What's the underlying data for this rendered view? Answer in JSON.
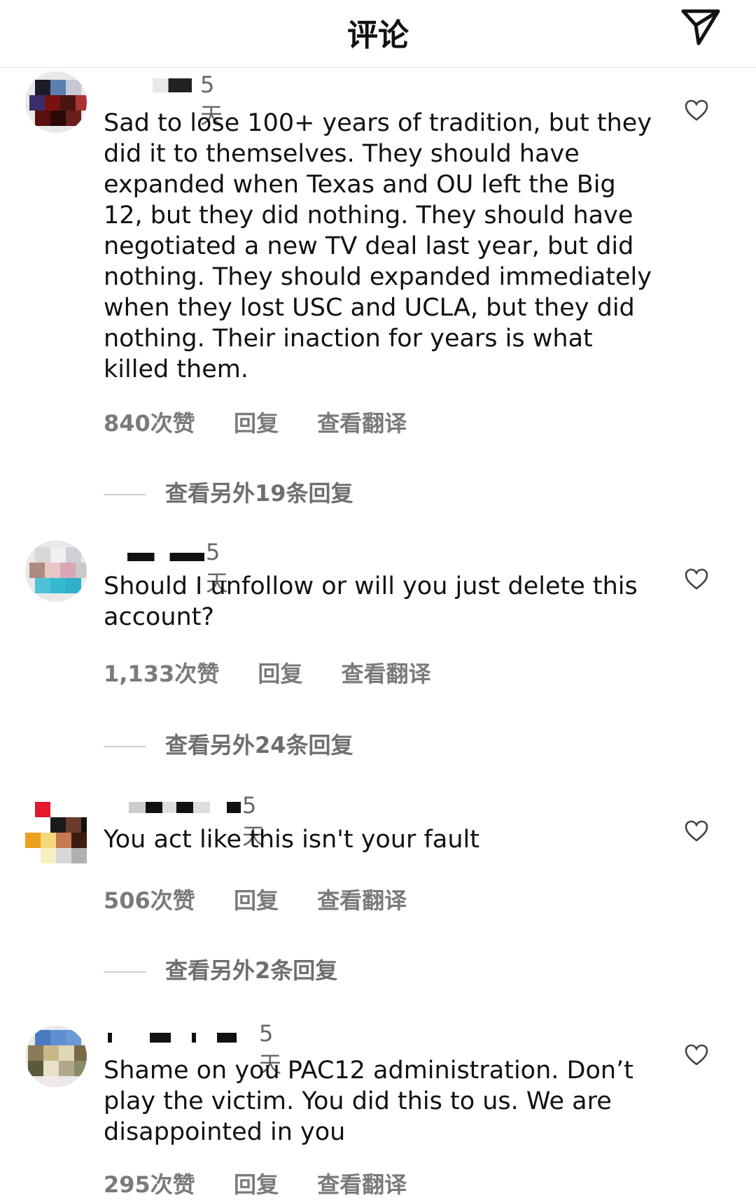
{
  "header": {
    "title": "评论",
    "send_icon": "paper-plane-icon"
  },
  "comments": [
    {
      "time": "5天",
      "text": "Sad to lose 100+ years of tradition, but they did it to themselves. They should have expanded when Texas and OU left the Big 12, but they did nothing. They should have negotiated a new TV deal last year, but did nothing. They should expanded immediately when they lost USC and UCLA, but they did nothing. Their inaction for years is what killed them.",
      "likes": "840次赞",
      "reply": "回复",
      "translate": "查看翻译",
      "more_replies": "查看另外19条回复"
    },
    {
      "time": "5天",
      "text": "Should I unfollow or will you just delete this account?",
      "likes": "1,133次赞",
      "reply": "回复",
      "translate": "查看翻译",
      "more_replies": "查看另外24条回复"
    },
    {
      "time": "5天",
      "text": "You act like this isn't your fault",
      "likes": "506次赞",
      "reply": "回复",
      "translate": "查看翻译",
      "more_replies": "查看另外2条回复"
    },
    {
      "time": "5天",
      "text": "Shame on you PAC12 administration. Don’t play the victim. You did this to us.  We are disappointed in you",
      "likes": "295次赞",
      "reply": "回复",
      "translate": "查看翻译"
    }
  ]
}
